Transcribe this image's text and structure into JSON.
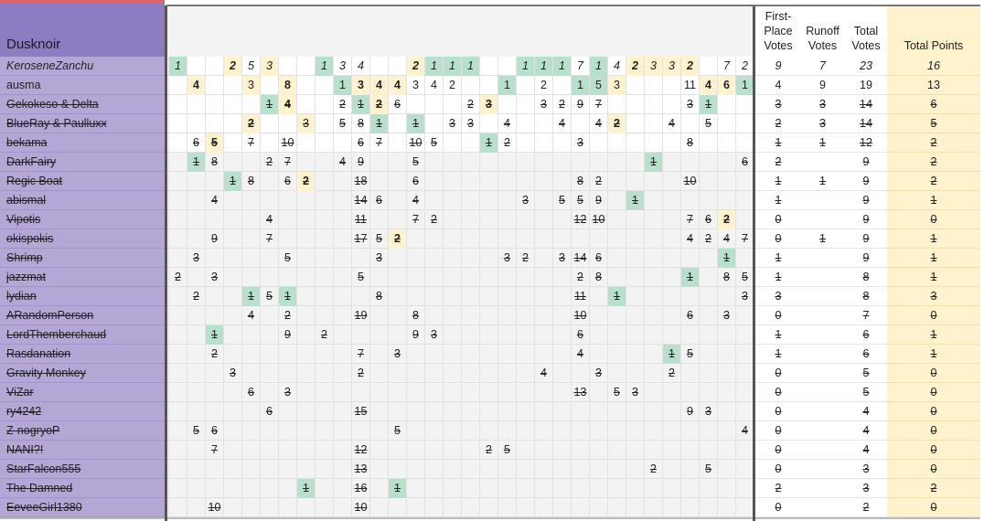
{
  "title": "Dusknoir",
  "headers": {
    "first_place_votes": "First-Place Votes",
    "runoff_votes": "Runoff Votes",
    "total_votes": "Total Votes",
    "total_points": "Total Points"
  },
  "colors": {
    "name_bg": "#b4a7d6",
    "title_bg": "#8e7cc3",
    "green_highlight": "#b7e1cd",
    "yellow_highlight": "#fff2cc",
    "points_bg": "#fff2cc"
  },
  "rows": [
    {
      "name": "KeroseneZanchu",
      "style": "italic",
      "first": "9",
      "runoff": "7",
      "total": "23",
      "points": "16",
      "cells": [
        [
          0,
          "1",
          "g",
          0
        ],
        [
          3,
          "2",
          "y",
          1
        ],
        [
          4,
          "5",
          "",
          0
        ],
        [
          5,
          "3",
          "y",
          0
        ],
        [
          8,
          "1",
          "g",
          0
        ],
        [
          9,
          "3",
          "",
          0
        ],
        [
          10,
          "4",
          "",
          0
        ],
        [
          13,
          "2",
          "y",
          1
        ],
        [
          14,
          "1",
          "g",
          0
        ],
        [
          15,
          "1",
          "g",
          0
        ],
        [
          16,
          "1",
          "g",
          0
        ],
        [
          19,
          "1",
          "g",
          0
        ],
        [
          20,
          "1",
          "g",
          0
        ],
        [
          21,
          "1",
          "g",
          0
        ],
        [
          22,
          "7",
          "",
          0
        ],
        [
          23,
          "1",
          "g",
          0
        ],
        [
          24,
          "4",
          "",
          0
        ],
        [
          25,
          "2",
          "y",
          1
        ],
        [
          26,
          "3",
          "y",
          0
        ],
        [
          27,
          "3",
          "y",
          0
        ],
        [
          28,
          "2",
          "y",
          1
        ],
        [
          30,
          "7",
          "",
          0
        ],
        [
          31,
          "2",
          "",
          0
        ]
      ]
    },
    {
      "name": "ausma",
      "style": "",
      "first": "4",
      "runoff": "9",
      "total": "19",
      "points": "13",
      "cells": [
        [
          1,
          "4",
          "y",
          1
        ],
        [
          4,
          "3",
          "y",
          0
        ],
        [
          6,
          "8",
          "y",
          1
        ],
        [
          9,
          "1",
          "g",
          0
        ],
        [
          10,
          "3",
          "y",
          1
        ],
        [
          11,
          "4",
          "y",
          1
        ],
        [
          12,
          "4",
          "y",
          1
        ],
        [
          13,
          "3",
          "",
          0
        ],
        [
          14,
          "4",
          "",
          0
        ],
        [
          15,
          "2",
          "",
          0
        ],
        [
          18,
          "1",
          "g",
          0
        ],
        [
          20,
          "2",
          "",
          0
        ],
        [
          22,
          "1",
          "g",
          0
        ],
        [
          23,
          "5",
          "g",
          0
        ],
        [
          24,
          "3",
          "y",
          0
        ],
        [
          28,
          "11",
          "",
          0
        ],
        [
          29,
          "4",
          "y",
          1
        ],
        [
          30,
          "6",
          "y",
          1
        ],
        [
          31,
          "1",
          "g",
          0
        ]
      ]
    },
    {
      "name": "Gekokeso & Delta",
      "style": "struck",
      "first": "3",
      "runoff": "3",
      "total": "14",
      "points": "6",
      "cells": [
        [
          5,
          "1",
          "g",
          0
        ],
        [
          6,
          "4",
          "y",
          1
        ],
        [
          9,
          "2",
          "",
          0
        ],
        [
          10,
          "1",
          "g",
          0
        ],
        [
          11,
          "2",
          "y",
          1
        ],
        [
          12,
          "6",
          "",
          0
        ],
        [
          16,
          "2",
          "",
          0
        ],
        [
          17,
          "3",
          "y",
          1
        ],
        [
          20,
          "3",
          "",
          0
        ],
        [
          21,
          "2",
          "",
          0
        ],
        [
          22,
          "9",
          "",
          0
        ],
        [
          23,
          "7",
          "",
          0
        ],
        [
          28,
          "3",
          "",
          0
        ],
        [
          29,
          "1",
          "g",
          0
        ]
      ]
    },
    {
      "name": "BlueRay & Paulluxx",
      "style": "struck",
      "first": "2",
      "runoff": "3",
      "total": "14",
      "points": "5",
      "cells": [
        [
          4,
          "2",
          "y",
          1
        ],
        [
          7,
          "3",
          "y",
          0
        ],
        [
          9,
          "5",
          "",
          0
        ],
        [
          10,
          "8",
          "",
          0
        ],
        [
          11,
          "1",
          "g",
          0
        ],
        [
          13,
          "1",
          "g",
          0
        ],
        [
          15,
          "3",
          "",
          0
        ],
        [
          16,
          "3",
          "",
          0
        ],
        [
          18,
          "4",
          "",
          0
        ],
        [
          21,
          "4",
          "",
          0
        ],
        [
          23,
          "4",
          "",
          0
        ],
        [
          24,
          "2",
          "y",
          1
        ],
        [
          27,
          "4",
          "",
          0
        ],
        [
          29,
          "5",
          "",
          0
        ]
      ]
    },
    {
      "name": "bekama",
      "style": "struck",
      "first": "1",
      "runoff": "1",
      "total": "12",
      "points": "2",
      "cells": [
        [
          1,
          "6",
          "",
          0
        ],
        [
          2,
          "5",
          "y",
          1
        ],
        [
          4,
          "7",
          "",
          0
        ],
        [
          6,
          "10",
          "",
          0
        ],
        [
          10,
          "6",
          "",
          0
        ],
        [
          11,
          "7",
          "",
          0
        ],
        [
          13,
          "10",
          "",
          0
        ],
        [
          14,
          "5",
          "",
          0
        ],
        [
          17,
          "1",
          "g",
          0
        ],
        [
          18,
          "2",
          "",
          0
        ],
        [
          22,
          "3",
          "",
          0
        ],
        [
          28,
          "8",
          "",
          0
        ]
      ]
    },
    {
      "name": "DarkFairy",
      "style": "struck",
      "first": "2",
      "runoff": "",
      "total": "9",
      "points": "2",
      "cells": [
        [
          1,
          "1",
          "g",
          0
        ],
        [
          2,
          "8",
          "",
          0
        ],
        [
          5,
          "2",
          "",
          0
        ],
        [
          6,
          "7",
          "",
          0
        ],
        [
          9,
          "4",
          "",
          0
        ],
        [
          10,
          "9",
          "",
          0
        ],
        [
          13,
          "5",
          "",
          0
        ],
        [
          26,
          "1",
          "g",
          0
        ],
        [
          31,
          "6",
          "",
          0
        ]
      ]
    },
    {
      "name": "Regic Boat",
      "style": "struck",
      "first": "1",
      "runoff": "1",
      "total": "9",
      "points": "2",
      "cells": [
        [
          3,
          "1",
          "g",
          0
        ],
        [
          4,
          "8",
          "",
          0
        ],
        [
          6,
          "6",
          "",
          0
        ],
        [
          7,
          "2",
          "y",
          1
        ],
        [
          10,
          "18",
          "",
          0
        ],
        [
          13,
          "6",
          "",
          0
        ],
        [
          22,
          "8",
          "",
          0
        ],
        [
          23,
          "2",
          "",
          0
        ],
        [
          28,
          "10",
          "",
          0
        ]
      ]
    },
    {
      "name": "abismal",
      "style": "struck",
      "first": "1",
      "runoff": "",
      "total": "9",
      "points": "1",
      "cells": [
        [
          2,
          "4",
          "",
          0
        ],
        [
          10,
          "14",
          "",
          0
        ],
        [
          11,
          "6",
          "",
          0
        ],
        [
          13,
          "4",
          "",
          0
        ],
        [
          19,
          "3",
          "",
          0
        ],
        [
          21,
          "5",
          "",
          0
        ],
        [
          22,
          "5",
          "",
          0
        ],
        [
          23,
          "9",
          "",
          0
        ],
        [
          25,
          "1",
          "g",
          0
        ]
      ]
    },
    {
      "name": "Vipotis",
      "style": "struck",
      "first": "0",
      "runoff": "",
      "total": "9",
      "points": "0",
      "cells": [
        [
          5,
          "4",
          "",
          0
        ],
        [
          10,
          "11",
          "",
          0
        ],
        [
          13,
          "7",
          "",
          0
        ],
        [
          14,
          "2",
          "",
          0
        ],
        [
          22,
          "12",
          "",
          0
        ],
        [
          23,
          "10",
          "",
          0
        ],
        [
          28,
          "7",
          "",
          0
        ],
        [
          29,
          "6",
          "",
          0
        ],
        [
          30,
          "2",
          "y",
          1
        ]
      ]
    },
    {
      "name": "okispokis",
      "style": "struck",
      "first": "0",
      "runoff": "1",
      "total": "9",
      "points": "1",
      "cells": [
        [
          2,
          "9",
          "",
          0
        ],
        [
          5,
          "7",
          "",
          0
        ],
        [
          10,
          "17",
          "",
          0
        ],
        [
          11,
          "5",
          "",
          0
        ],
        [
          12,
          "2",
          "y",
          1
        ],
        [
          28,
          "4",
          "",
          0
        ],
        [
          29,
          "2",
          "",
          0
        ],
        [
          30,
          "4",
          "",
          0
        ],
        [
          31,
          "7",
          "",
          0
        ]
      ]
    },
    {
      "name": "Shrimp",
      "style": "struck",
      "first": "1",
      "runoff": "",
      "total": "9",
      "points": "1",
      "cells": [
        [
          1,
          "3",
          "",
          0
        ],
        [
          6,
          "5",
          "",
          0
        ],
        [
          11,
          "3",
          "",
          0
        ],
        [
          18,
          "3",
          "",
          0
        ],
        [
          19,
          "2",
          "",
          0
        ],
        [
          21,
          "3",
          "",
          0
        ],
        [
          22,
          "14",
          "",
          0
        ],
        [
          23,
          "6",
          "",
          0
        ],
        [
          30,
          "1",
          "g",
          0
        ]
      ]
    },
    {
      "name": "jazzmat",
      "style": "struck",
      "first": "1",
      "runoff": "",
      "total": "8",
      "points": "1",
      "cells": [
        [
          0,
          "2",
          "",
          0
        ],
        [
          2,
          "3",
          "",
          0
        ],
        [
          10,
          "5",
          "",
          0
        ],
        [
          22,
          "2",
          "",
          0
        ],
        [
          23,
          "8",
          "",
          0
        ],
        [
          28,
          "1",
          "g",
          0
        ],
        [
          30,
          "8",
          "",
          0
        ],
        [
          31,
          "5",
          "",
          0
        ]
      ]
    },
    {
      "name": "lydian",
      "style": "struck",
      "first": "3",
      "runoff": "",
      "total": "8",
      "points": "3",
      "cells": [
        [
          1,
          "2",
          "",
          0
        ],
        [
          4,
          "1",
          "g",
          0
        ],
        [
          5,
          "5",
          "",
          0
        ],
        [
          6,
          "1",
          "g",
          0
        ],
        [
          11,
          "8",
          "",
          0
        ],
        [
          22,
          "11",
          "",
          0
        ],
        [
          24,
          "1",
          "g",
          0
        ],
        [
          31,
          "3",
          "",
          0
        ]
      ]
    },
    {
      "name": "ARandomPerson",
      "style": "struck",
      "first": "0",
      "runoff": "",
      "total": "7",
      "points": "0",
      "cells": [
        [
          4,
          "4",
          "",
          0
        ],
        [
          6,
          "2",
          "",
          0
        ],
        [
          10,
          "19",
          "",
          0
        ],
        [
          13,
          "8",
          "",
          0
        ],
        [
          22,
          "10",
          "",
          0
        ],
        [
          28,
          "6",
          "",
          0
        ],
        [
          30,
          "3",
          "",
          0
        ]
      ]
    },
    {
      "name": "LordThemberchaud",
      "style": "struck",
      "first": "1",
      "runoff": "",
      "total": "6",
      "points": "1",
      "cells": [
        [
          2,
          "1",
          "g",
          0
        ],
        [
          6,
          "9",
          "",
          0
        ],
        [
          8,
          "2",
          "",
          0
        ],
        [
          13,
          "9",
          "",
          0
        ],
        [
          14,
          "3",
          "",
          0
        ],
        [
          22,
          "6",
          "",
          0
        ]
      ]
    },
    {
      "name": "Rasdanation",
      "style": "struck",
      "first": "1",
      "runoff": "",
      "total": "6",
      "points": "1",
      "cells": [
        [
          2,
          "2",
          "",
          0
        ],
        [
          10,
          "7",
          "",
          0
        ],
        [
          12,
          "3",
          "",
          0
        ],
        [
          22,
          "4",
          "",
          0
        ],
        [
          27,
          "1",
          "g",
          0
        ],
        [
          28,
          "5",
          "",
          0
        ]
      ]
    },
    {
      "name": "Gravity Monkey",
      "style": "struck",
      "first": "0",
      "runoff": "",
      "total": "5",
      "points": "0",
      "cells": [
        [
          3,
          "3",
          "",
          0
        ],
        [
          10,
          "2",
          "",
          0
        ],
        [
          20,
          "4",
          "",
          0
        ],
        [
          23,
          "3",
          "",
          0
        ],
        [
          27,
          "2",
          "",
          0
        ]
      ]
    },
    {
      "name": "ViZar",
      "style": "struck",
      "first": "0",
      "runoff": "",
      "total": "5",
      "points": "0",
      "cells": [
        [
          4,
          "6",
          "",
          0
        ],
        [
          6,
          "3",
          "",
          0
        ],
        [
          22,
          "13",
          "",
          0
        ],
        [
          24,
          "5",
          "",
          0
        ],
        [
          25,
          "3",
          "",
          0
        ]
      ]
    },
    {
      "name": "ry4242",
      "style": "struck",
      "first": "0",
      "runoff": "",
      "total": "4",
      "points": "0",
      "cells": [
        [
          5,
          "6",
          "",
          0
        ],
        [
          10,
          "15",
          "",
          0
        ],
        [
          28,
          "9",
          "",
          0
        ],
        [
          29,
          "3",
          "",
          0
        ]
      ]
    },
    {
      "name": "Z-nogryoP",
      "style": "struck",
      "first": "0",
      "runoff": "",
      "total": "4",
      "points": "0",
      "cells": [
        [
          1,
          "5",
          "",
          0
        ],
        [
          2,
          "6",
          "",
          0
        ],
        [
          12,
          "5",
          "",
          0
        ],
        [
          31,
          "4",
          "",
          0
        ]
      ]
    },
    {
      "name": "NANI?!",
      "style": "struck",
      "first": "0",
      "runoff": "",
      "total": "4",
      "points": "0",
      "cells": [
        [
          2,
          "7",
          "",
          0
        ],
        [
          10,
          "12",
          "",
          0
        ],
        [
          17,
          "2",
          "",
          0
        ],
        [
          18,
          "5",
          "",
          0
        ]
      ]
    },
    {
      "name": "StarFalcon555",
      "style": "struck",
      "first": "0",
      "runoff": "",
      "total": "3",
      "points": "0",
      "cells": [
        [
          10,
          "13",
          "",
          0
        ],
        [
          26,
          "2",
          "",
          0
        ],
        [
          29,
          "5",
          "",
          0
        ]
      ]
    },
    {
      "name": "The Damned",
      "style": "struck",
      "first": "2",
      "runoff": "",
      "total": "3",
      "points": "2",
      "cells": [
        [
          7,
          "1",
          "g",
          0
        ],
        [
          10,
          "16",
          "",
          0
        ],
        [
          12,
          "1",
          "g",
          0
        ]
      ]
    },
    {
      "name": "EeveeGirl1380",
      "style": "struck",
      "first": "0",
      "runoff": "",
      "total": "2",
      "points": "0",
      "cells": [
        [
          2,
          "10",
          "",
          0
        ],
        [
          10,
          "10",
          "",
          0
        ]
      ]
    }
  ]
}
